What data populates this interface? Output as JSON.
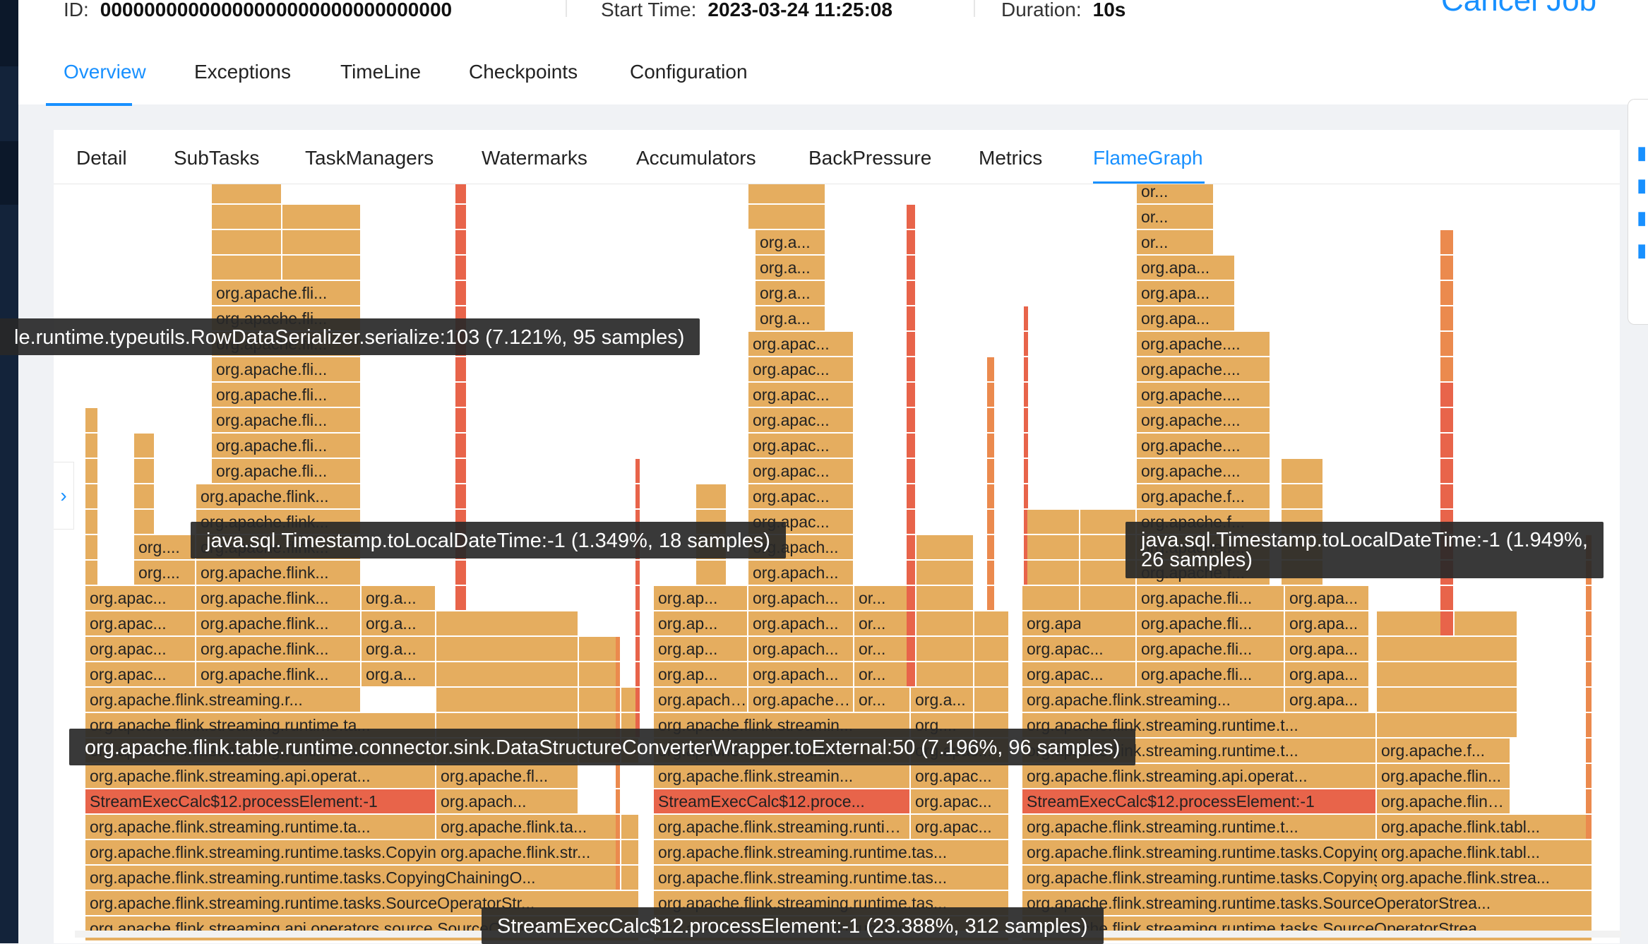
{
  "job": {
    "id_label": "ID:",
    "id_value": "00000000000000000000000000000000",
    "start_label": "Start Time:",
    "start_value": "2023-03-24 11:25:08",
    "duration_label": "Duration:",
    "duration_value": "10s",
    "cancel_label": "Cancel Job"
  },
  "main_tabs": [
    {
      "label": "Overview",
      "active": true
    },
    {
      "label": "Exceptions"
    },
    {
      "label": "TimeLine"
    },
    {
      "label": "Checkpoints"
    },
    {
      "label": "Configuration"
    }
  ],
  "vertex_tabs": [
    {
      "label": "Detail"
    },
    {
      "label": "SubTasks"
    },
    {
      "label": "TaskManagers"
    },
    {
      "label": "Watermarks"
    },
    {
      "label": "Accumulators"
    },
    {
      "label": "BackPressure"
    },
    {
      "label": "Metrics"
    },
    {
      "label": "FlameGraph",
      "active": true
    }
  ],
  "flamegraph": {
    "tooltips": [
      "le.runtime.typeutils.RowDataSerializer.serialize:103 (7.121%, 95 samples)",
      "java.sql.Timestamp.toLocalDateTime:-1 (1.349%, 18 samples)",
      "java.sql.Timestamp.toLocalDateTime:-1 (1.949%,",
      "26 samples)",
      "org.apache.flink.table.runtime.connector.sink.DataStructureConverterWrapper.toExternal:50 (7.196%, 96 samples)",
      "StreamExecCalc$12.processElement:-1 (23.388%, 312 samples)"
    ],
    "frame_labels": [
      "org.apache.flink.streaming.api.operators.source.SourceOutput...",
      "org.apache.flink.streaming.runtime.tasks.SourceOperatorStr...",
      "org.apache.flink.streaming.runtime.tasks.CopyingChainingO...",
      "org.apache.flink.streaming.runtime.ta...",
      "StreamExecCalc$12.processElement:-1",
      "org.apache.flink.streaming.api.operat...",
      "org.apache.flink.streaming.r...",
      "org.apac...",
      "org.apache.flink...",
      "org.a...",
      "org....",
      "org.apache.fli...",
      "org.apac...",
      "org.apache.flink.str...",
      "org.apache.flink.ta...",
      "org.apach...",
      "org.apache.fl...",
      "org.apache.flink.streaming.runtime.tas...",
      "StreamExecCalc$12.proce...",
      "org.apache.flink.streamin...",
      "org.apache.flink.str...",
      "org.apach...",
      "org.apac...",
      "org.a...",
      "or...",
      "org.ap...",
      "org.apache.flink.streaming.runtime.tasks.SourceOperatorStrea...",
      "org.apache.flink.streaming.runtime.tasks.CopyingChainingOut...",
      "org.apache.flink.streaming.runtime.t...",
      "org.apache.flink.streaming.api.operat...",
      "org.apache.flink.streaming...",
      "org.apache.fli...",
      "org.apache.f...",
      "org.apache....",
      "org.apa...",
      "org.apache.flink.strea...",
      "org.apache.flink.tabl...",
      "org.apache.flink.t...",
      "org.apache.flin..."
    ]
  },
  "colors": {
    "accent": "#1890ff",
    "frame": "#e5ad5f",
    "hot": "#e8644a",
    "warm": "#eb8a4e"
  }
}
